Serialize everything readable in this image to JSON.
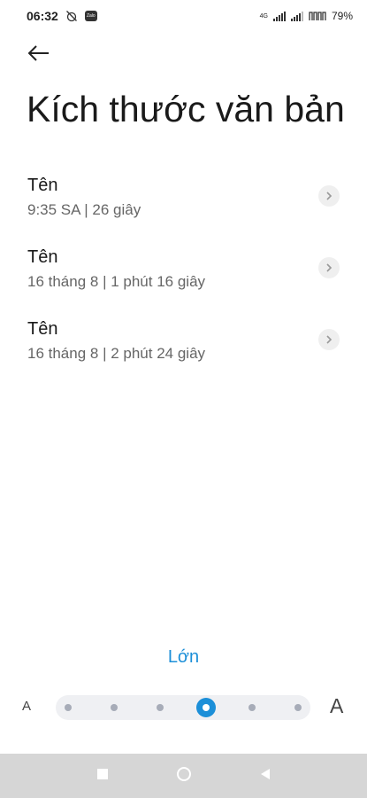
{
  "status_bar": {
    "time": "06:32",
    "network": "4G",
    "battery": "79%"
  },
  "page": {
    "title": "Kích thước văn bản"
  },
  "items": [
    {
      "title": "Tên",
      "subtitle": "9:35 SA | 26 giây"
    },
    {
      "title": "Tên",
      "subtitle": "16 tháng 8 | 1 phút 16 giây"
    },
    {
      "title": "Tên",
      "subtitle": "16 tháng 8 | 2 phút 24 giây"
    }
  ],
  "text_size": {
    "label": "Lớn",
    "small_marker": "A",
    "large_marker": "A",
    "steps": 6,
    "selected_step": 4
  },
  "colors": {
    "accent": "#1c8fd8",
    "nav_bar": "#d6d6d6"
  },
  "icons": {
    "back": "arrow-left-icon",
    "chevron": "chevron-right-icon",
    "nav_recents": "square-icon",
    "nav_home": "circle-icon",
    "nav_back": "triangle-left-icon"
  }
}
